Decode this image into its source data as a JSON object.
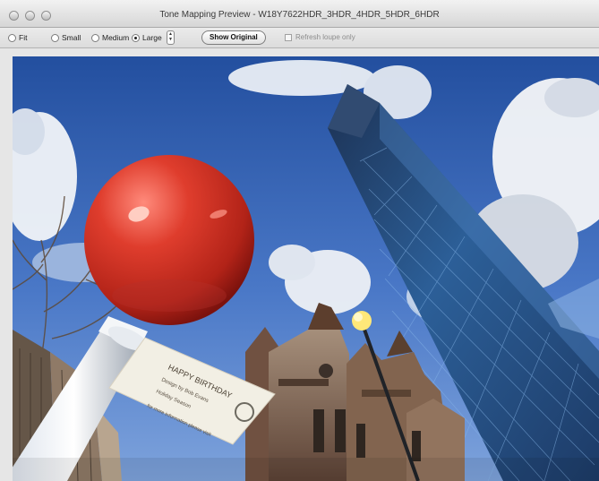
{
  "window": {
    "title": "Tone Mapping Preview - W18Y7622HDR_3HDR_4HDR_5HDR_6HDR"
  },
  "toolbar": {
    "size_options": [
      "Fit",
      "Small",
      "Medium",
      "Large"
    ],
    "selected_size": "Large",
    "show_original_label": "Show Original",
    "refresh_loupe_label": "Refresh loupe only",
    "refresh_loupe_checked": false
  },
  "preview": {
    "sign": {
      "line1": "HAPPY BIRTHDAY",
      "line2": "Design by Bob Evans",
      "line3": "Holiday Season",
      "line4": "for more information please visit"
    }
  },
  "colors": {
    "sky": "#3f67b8",
    "ball": "#d73a2b",
    "glass": "#244a7c"
  }
}
